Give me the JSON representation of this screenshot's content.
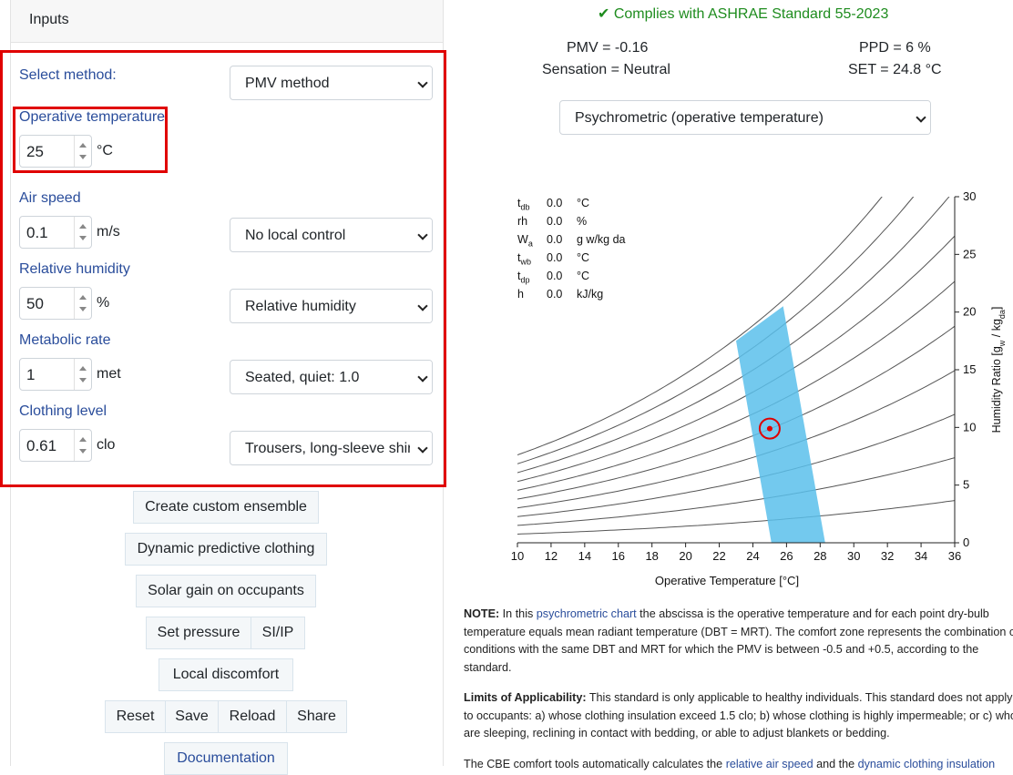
{
  "compliance": {
    "icon": "check-icon",
    "text": "✔ Complies with ASHRAE Standard 55-2023",
    "color": "#1e8c1e"
  },
  "results": {
    "pmv": "PMV = -0.16",
    "ppd": "PPD = 6 %",
    "sensation": "Sensation = Neutral",
    "set": "SET = 24.8 °C"
  },
  "chart_select": {
    "value": "Psychrometric (operative temperature)"
  },
  "inputs": {
    "header": "Inputs",
    "method": {
      "label": "Select method:",
      "value": "PMV method"
    },
    "operative_temperature": {
      "label": "Operative temperature",
      "value": "25",
      "unit": "°C"
    },
    "air_speed": {
      "label": "Air speed",
      "value": "0.1",
      "unit": "m/s",
      "select": "No local control"
    },
    "relative_humidity": {
      "label": "Relative humidity",
      "value": "50",
      "unit": "%",
      "select": "Relative humidity"
    },
    "metabolic_rate": {
      "label": "Metabolic rate",
      "value": "1",
      "unit": "met",
      "select": "Seated, quiet: 1.0"
    },
    "clothing_level": {
      "label": "Clothing level",
      "value": "0.61",
      "unit": "clo",
      "select": "Trousers, long-sleeve shirt"
    }
  },
  "buttons": {
    "custom_ensemble": "Create custom ensemble",
    "dynamic_clothing": "Dynamic predictive clothing",
    "solar_gain": "Solar gain on occupants",
    "set_pressure": "Set pressure",
    "si_ip": "SI/IP",
    "local_discomfort": "Local discomfort",
    "reset": "Reset",
    "save": "Save",
    "reload": "Reload",
    "share": "Share",
    "documentation": "Documentation"
  },
  "readout": [
    {
      "symbol": "t",
      "sub": "db",
      "value": "0.0",
      "unit": "°C"
    },
    {
      "symbol": "rh",
      "sub": "",
      "value": "0.0",
      "unit": "%"
    },
    {
      "symbol": "W",
      "sub": "a",
      "value": "0.0",
      "unit": "g w/kg da"
    },
    {
      "symbol": "t",
      "sub": "wb",
      "value": "0.0",
      "unit": "°C"
    },
    {
      "symbol": "t",
      "sub": "dp",
      "value": "0.0",
      "unit": "°C"
    },
    {
      "symbol": "h",
      "sub": "",
      "value": "0.0",
      "unit": "kJ/kg"
    }
  ],
  "chart_data": {
    "type": "scatter",
    "xlabel": "Operative Temperature [°C]",
    "ylabel": "Humidity Ratio [gw / kgda]",
    "xlim": [
      10,
      36
    ],
    "ylim": [
      0,
      30
    ],
    "x_ticks": [
      10,
      12,
      14,
      16,
      18,
      20,
      22,
      24,
      26,
      28,
      30,
      32,
      34,
      36
    ],
    "y_ticks": [
      0,
      5,
      10,
      15,
      20,
      25,
      30
    ],
    "rh_curves_percent": [
      10,
      20,
      30,
      40,
      50,
      60,
      70,
      80,
      90,
      100
    ],
    "comfort_zone": [
      [
        23.0,
        17.5
      ],
      [
        25.8,
        20.5
      ],
      [
        28.3,
        0.0
      ],
      [
        25.1,
        0.0
      ]
    ],
    "point": {
      "x": 25.0,
      "y": 9.9
    },
    "zone_color": "#5bc0eb",
    "point_color": "#e00000"
  },
  "notes": {
    "note_label": "NOTE:",
    "note_p1": " In this ",
    "note_link": "psychrometric chart",
    "note_p2": " the abscissa is the operative temperature and for each point dry-bulb temperature equals mean radiant temperature (DBT = MRT). The comfort zone represents the combination of conditions with the same DBT and MRT for which the PMV is between -0.5 and +0.5, according to the standard.",
    "limits_label": "Limits of Applicability:",
    "limits_text": " This standard is only applicable to healthy individuals. This standard does not apply to occupants: a) whose clothing insulation exceed 1.5 clo; b) whose clothing is highly impermeable; or c) who are sleeping, reclining in contact with bedding, or able to adjust blankets or bedding.",
    "cbe_p1": "The CBE comfort tools automatically calculates the ",
    "cbe_link1": "relative air speed",
    "cbe_p2": " and the ",
    "cbe_link2": "dynamic clothing insulation"
  }
}
